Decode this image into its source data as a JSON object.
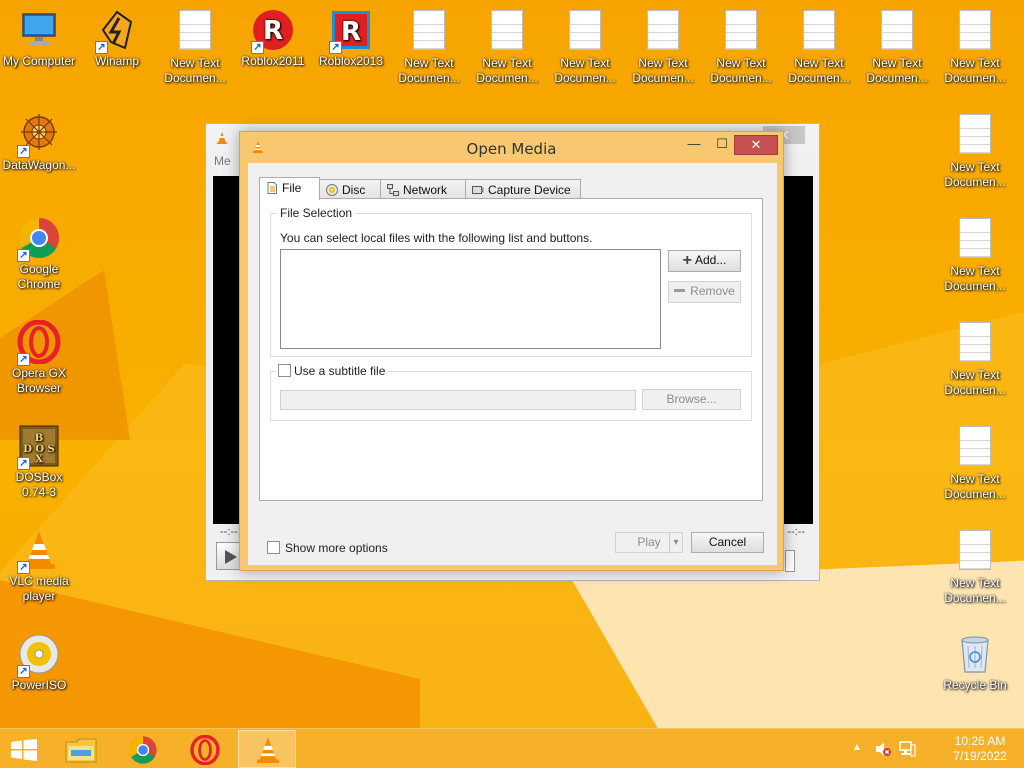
{
  "desktop": {
    "left_icons": [
      {
        "label1": "My Computer",
        "label2": ""
      },
      {
        "label1": "DataWagon...",
        "label2": ""
      },
      {
        "label1": "Google",
        "label2": "Chrome"
      },
      {
        "label1": "Opera GX",
        "label2": "Browser"
      },
      {
        "label1": "DOSBox",
        "label2": "0.74-3"
      },
      {
        "label1": "VLC media",
        "label2": "player"
      },
      {
        "label1": "PowerISO",
        "label2": ""
      }
    ],
    "top_icons": [
      {
        "label1": "Winamp",
        "label2": ""
      },
      {
        "label1": "New Text",
        "label2": "Documen..."
      },
      {
        "label1": "Roblox2011",
        "label2": ""
      },
      {
        "label1": "Roblox2013",
        "label2": ""
      },
      {
        "label1": "New Text",
        "label2": "Documen..."
      },
      {
        "label1": "New Text",
        "label2": "Documen..."
      },
      {
        "label1": "New Text",
        "label2": "Documen..."
      },
      {
        "label1": "New Text",
        "label2": "Documen..."
      },
      {
        "label1": "New Text",
        "label2": "Documen..."
      },
      {
        "label1": "New Text",
        "label2": "Documen..."
      },
      {
        "label1": "New Text",
        "label2": "Documen..."
      },
      {
        "label1": "New Text",
        "label2": "Documen..."
      }
    ],
    "right_icons": [
      {
        "label1": "New Text",
        "label2": "Documen..."
      },
      {
        "label1": "New Text",
        "label2": "Documen..."
      },
      {
        "label1": "New Text",
        "label2": "Documen..."
      },
      {
        "label1": "New Text",
        "label2": "Documen..."
      },
      {
        "label1": "New Text",
        "label2": "Documen..."
      },
      {
        "label1": "Recycle Bin",
        "label2": ""
      }
    ]
  },
  "vlc_main": {
    "menu_partial": "Me",
    "time_left": "--:--",
    "time_right": "--:--"
  },
  "dialog": {
    "title": "Open Media",
    "minimize": "—",
    "maximize": "☐",
    "close": "✕",
    "tabs": [
      {
        "label": "File",
        "icon": "file-icon"
      },
      {
        "label": "Disc",
        "icon": "disc-icon"
      },
      {
        "label": "Network",
        "icon": "network-icon"
      },
      {
        "label": "Capture Device",
        "icon": "capture-device-icon"
      }
    ],
    "file_selection": {
      "title": "File Selection",
      "hint": "You can select local files with the following list and buttons.",
      "add_label": "Add...",
      "remove_label": "Remove"
    },
    "subtitle": {
      "checkbox_label": "Use a subtitle file",
      "browse_label": "Browse...",
      "path_value": ""
    },
    "show_more_label": "Show more options",
    "play_label": "Play",
    "play_dropdown": "▾",
    "cancel_label": "Cancel"
  },
  "taskbar": {
    "time": "10:26 AM",
    "date": "7/19/2022",
    "pinned": [
      "start-icon",
      "file-explorer-icon",
      "chrome-icon",
      "opera-icon",
      "vlc-icon"
    ]
  },
  "colors": {
    "accent": "#f7c870",
    "close_red": "#c75050",
    "wallpaper": "#f9a800"
  }
}
